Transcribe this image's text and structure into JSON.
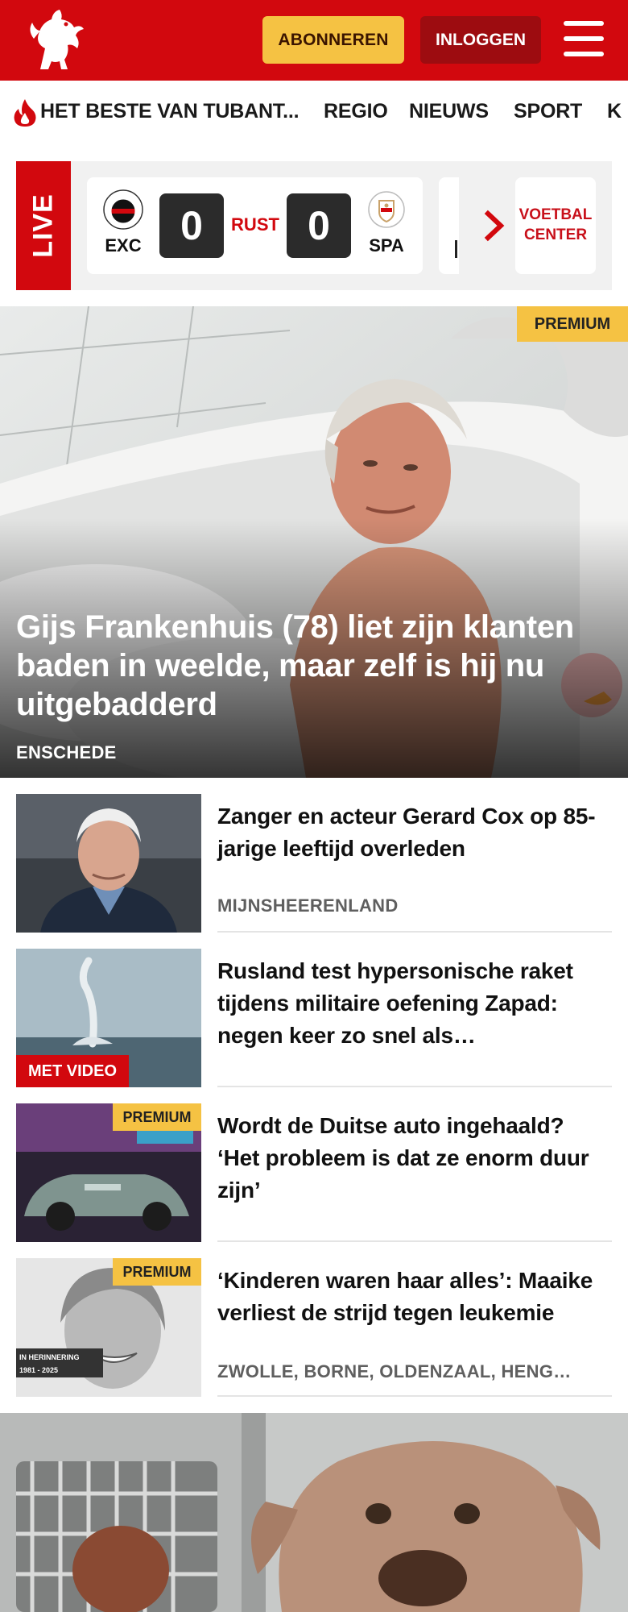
{
  "colors": {
    "brand_red": "#d2080e",
    "subscribe_yellow": "#f5c243",
    "login_dark_red": "#9d0c10"
  },
  "header": {
    "logo": "tubantia-horse-logo",
    "subscribe_label": "ABONNEREN",
    "login_label": "INLOGGEN",
    "menu_icon": "hamburger-menu-icon"
  },
  "nav": {
    "items": [
      {
        "label": "HET BESTE VAN TUBANT...",
        "icon": "flame-icon"
      },
      {
        "label": "REGIO"
      },
      {
        "label": "NIEUWS"
      },
      {
        "label": "SPORT"
      },
      {
        "label": "K"
      }
    ]
  },
  "live": {
    "label": "LIVE",
    "match": {
      "home": {
        "abbr": "EXC",
        "score": "0"
      },
      "status": "RUST",
      "away": {
        "abbr": "SPA",
        "score": "0"
      }
    },
    "next_icon": "chevron-right-icon",
    "voetbal_center": [
      "VOETBAL",
      "CENTER"
    ]
  },
  "hero": {
    "badge": "PREMIUM",
    "title": "Gijs Frankenhuis (78) liet zijn klanten baden in weelde, maar zelf is hij nu uitgebadderd",
    "location": "ENSCHEDE"
  },
  "articles": [
    {
      "title": "Zanger en acteur Gerard Cox op 85-jarige leeftijd overleden",
      "location": "MIJNSHEERENLAND",
      "badge": ""
    },
    {
      "title": "Rusland test hypersonische raket tijdens militaire oefening Zapad: negen keer zo snel als…",
      "location": "",
      "badge": "MET VIDEO"
    },
    {
      "title": "Wordt de Duitse auto ingehaald? ‘Het probleem is dat ze enorm duur zijn’",
      "location": "",
      "badge": "PREMIUM"
    },
    {
      "title": "‘Kinderen waren haar alles’: Maaike verliest de strijd tegen leukemie",
      "location": "ZWOLLE, BORNE, OLDENZAAL, HENG…",
      "badge": "PREMIUM",
      "image_caption": [
        "IN HERINNERING",
        "1981 - 2025"
      ]
    }
  ]
}
